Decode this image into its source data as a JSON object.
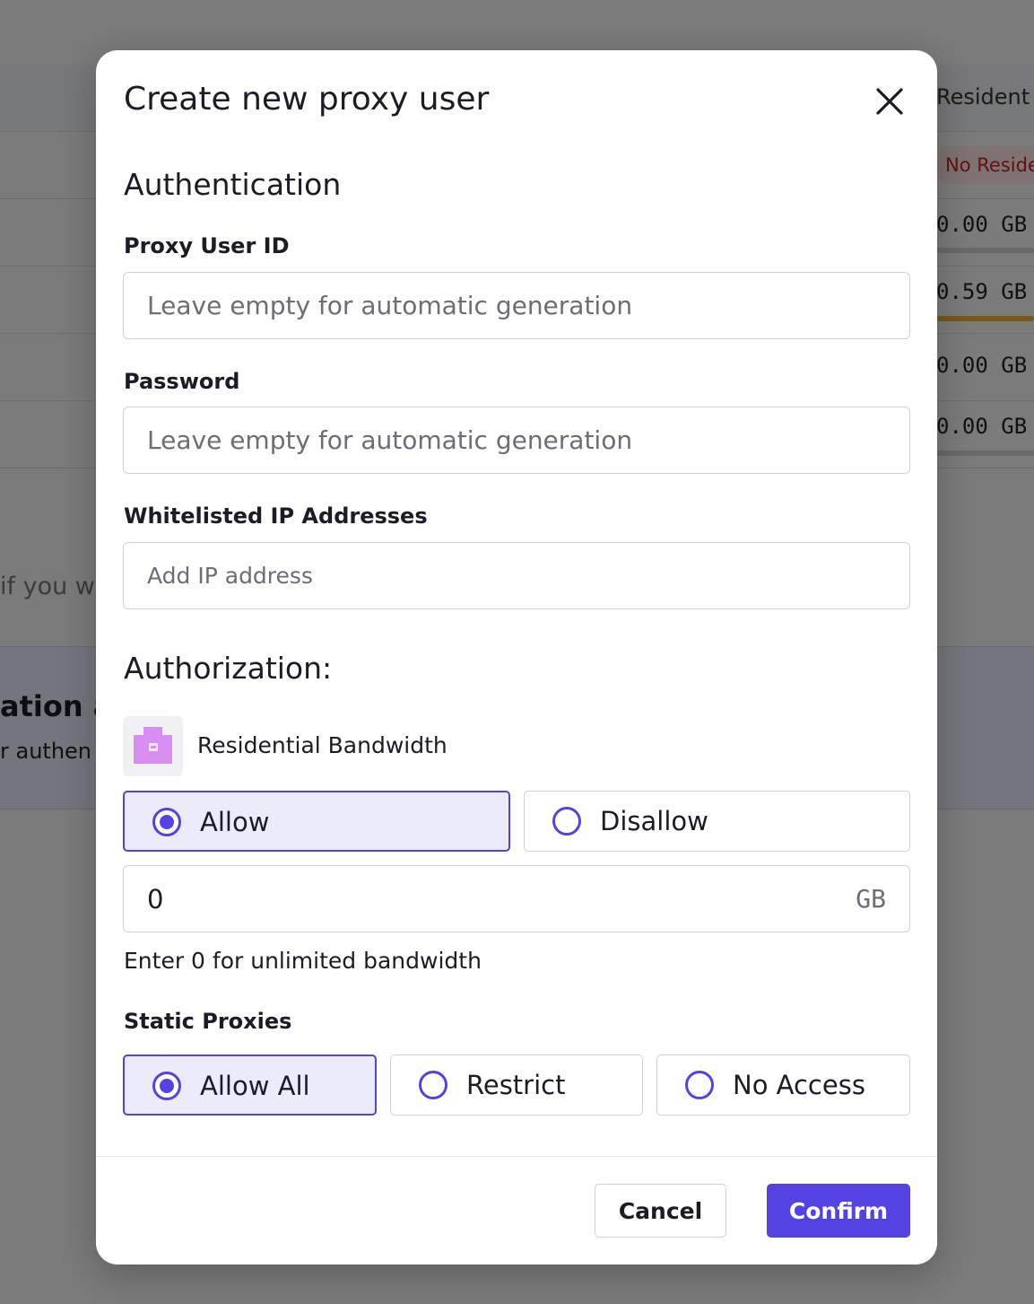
{
  "background": {
    "column_header": "Resident",
    "badge": "No Reside",
    "usage_rows": [
      "0.00 GB /",
      "0.59 GB /",
      "0.00 GB /",
      "0.00 GB /"
    ],
    "hint_fragment": "if you w",
    "panel_title_fragment": "ation a",
    "panel_sub_fragment": "r authen"
  },
  "modal": {
    "title": "Create new proxy user",
    "authentication": {
      "heading": "Authentication",
      "proxy_user_id": {
        "label": "Proxy User ID",
        "value": "",
        "placeholder": "Leave empty for automatic generation"
      },
      "password": {
        "label": "Password",
        "value": "",
        "placeholder": "Leave empty for automatic generation"
      },
      "whitelisted_ips": {
        "label": "Whitelisted IP Addresses",
        "value": "",
        "placeholder": "Add IP address"
      }
    },
    "authorization": {
      "heading": "Authorization:",
      "residential": {
        "label": "Residential Bandwidth",
        "options": [
          "Allow",
          "Disallow"
        ],
        "selected": "Allow",
        "bandwidth_value": "0",
        "bandwidth_unit": "GB",
        "hint": "Enter 0 for unlimited bandwidth"
      },
      "static_proxies": {
        "label": "Static Proxies",
        "options": [
          "Allow All",
          "Restrict",
          "No Access"
        ],
        "selected": "Allow All"
      }
    },
    "footer": {
      "cancel_label": "Cancel",
      "confirm_label": "Confirm"
    }
  },
  "colors": {
    "accent": "#5443e0",
    "selected_bg": "#ecebfc",
    "residential_icon": "#d88ef0"
  },
  "icons": {
    "close": "close-icon",
    "residential": "residential-building-icon"
  }
}
